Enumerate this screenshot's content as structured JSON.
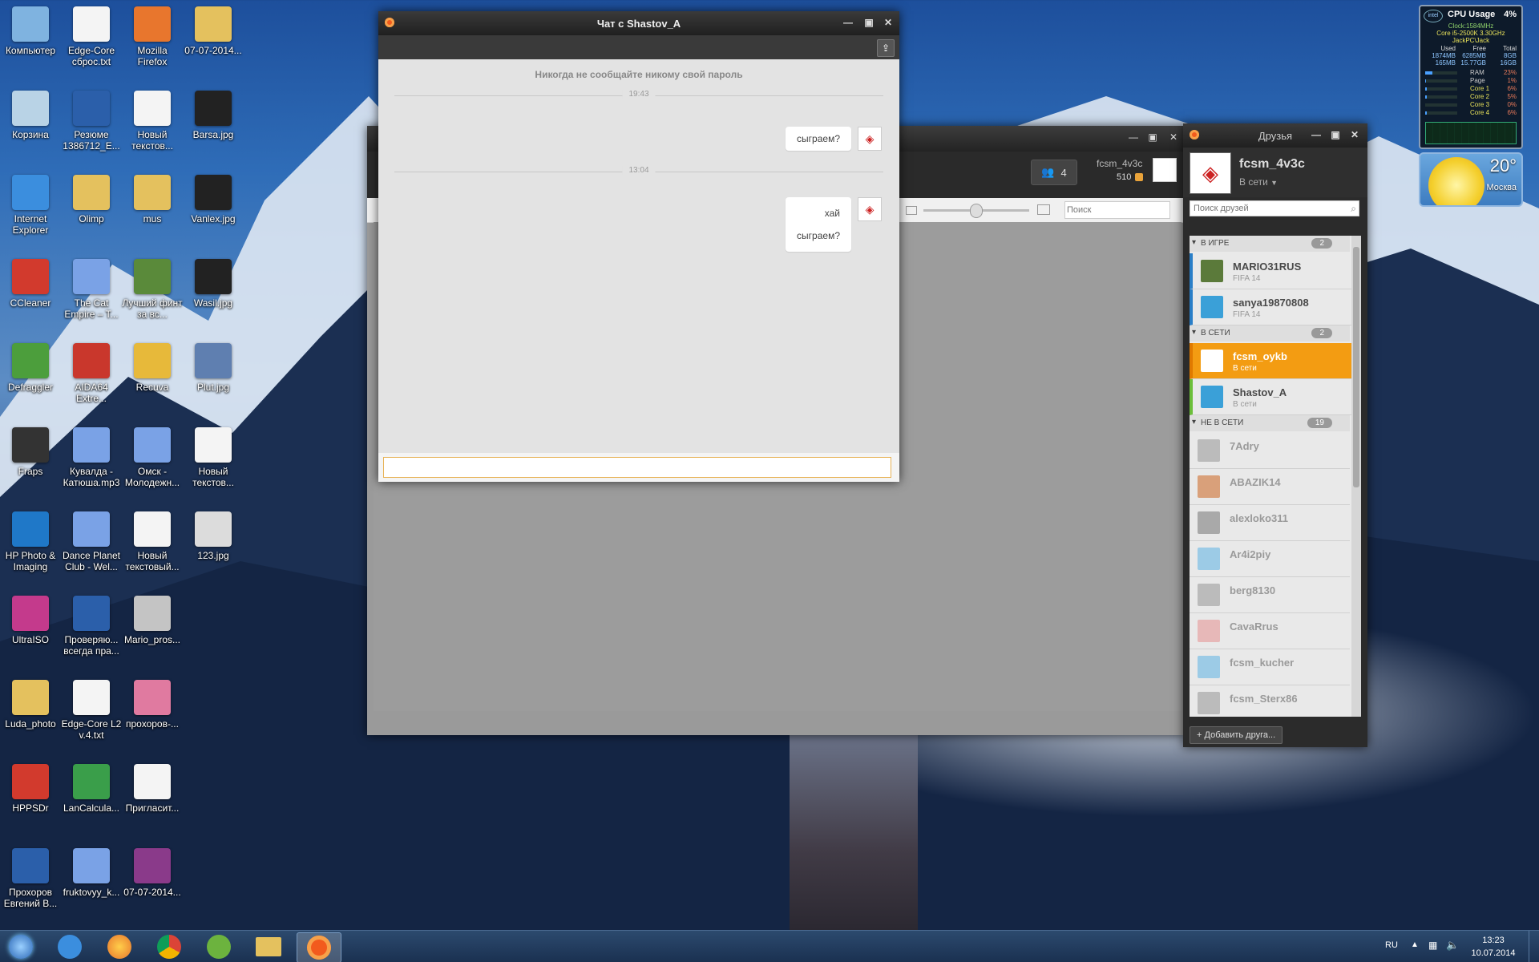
{
  "desktop_icons": [
    {
      "label": "Компьютер",
      "icon": "computer-icon",
      "color": "#7fb3e0"
    },
    {
      "label": "Edge-Core сброс.txt",
      "icon": "text-file-icon",
      "color": "#f4f4f4"
    },
    {
      "label": "Mozilla Firefox",
      "icon": "firefox-icon",
      "color": "#e8762d"
    },
    {
      "label": "07-07-2014...",
      "icon": "folder-icon",
      "color": "#e4c15e"
    },
    {
      "label": "Корзина",
      "icon": "recycle-bin-icon",
      "color": "#b9d3e6"
    },
    {
      "label": "Резюме 1386712_E...",
      "icon": "word-doc-icon",
      "color": "#2b5faa"
    },
    {
      "label": "Новый текстов...",
      "icon": "text-file-icon",
      "color": "#f4f4f4"
    },
    {
      "label": "Barsa.jpg",
      "icon": "image-icon",
      "color": "#222222"
    },
    {
      "label": "Internet Explorer",
      "icon": "ie-icon",
      "color": "#3b8ede"
    },
    {
      "label": "Olimp",
      "icon": "folder-icon",
      "color": "#e4c15e"
    },
    {
      "label": "mus",
      "icon": "folder-icon",
      "color": "#e4c15e"
    },
    {
      "label": "Vanlex.jpg",
      "icon": "image-icon",
      "color": "#222222"
    },
    {
      "label": "CCleaner",
      "icon": "ccleaner-icon",
      "color": "#d23a2d"
    },
    {
      "label": "The Cat Empire – T...",
      "icon": "audio-file-icon",
      "color": "#7aa2e6"
    },
    {
      "label": "Лучший финт за вс...",
      "icon": "video-file-icon",
      "color": "#5a8a3a"
    },
    {
      "label": "Wasil.jpg",
      "icon": "image-icon",
      "color": "#222222"
    },
    {
      "label": "Defraggler",
      "icon": "defraggler-icon",
      "color": "#4c9e3c"
    },
    {
      "label": "AIDA64 Extre...",
      "icon": "aida64-icon",
      "color": "#c9372c"
    },
    {
      "label": "Recuva",
      "icon": "recuva-icon",
      "color": "#e7b93a"
    },
    {
      "label": "Plut.jpg",
      "icon": "image-icon",
      "color": "#5f7fb0"
    },
    {
      "label": "Fraps",
      "icon": "fraps-icon",
      "color": "#333333"
    },
    {
      "label": "Кувалда - Катюша.mp3",
      "icon": "audio-file-icon",
      "color": "#7aa2e6"
    },
    {
      "label": "Омск - Молодежн...",
      "icon": "audio-file-icon",
      "color": "#7aa2e6"
    },
    {
      "label": "Новый текстов...",
      "icon": "text-file-icon",
      "color": "#f4f4f4"
    },
    {
      "label": "HP Photo & Imaging",
      "icon": "hp-photo-icon",
      "color": "#1f78c8"
    },
    {
      "label": "Dance Planet Club - Wel...",
      "icon": "audio-file-icon",
      "color": "#7aa2e6"
    },
    {
      "label": "Новый текстовый...",
      "icon": "text-file-icon",
      "color": "#f4f4f4"
    },
    {
      "label": "123.jpg",
      "icon": "image-icon",
      "color": "#dcdcdc"
    },
    {
      "label": "UltraISO",
      "icon": "ultraiso-icon",
      "color": "#c43a8c"
    },
    {
      "label": "Проверяю... всегда пра...",
      "icon": "word-doc-icon",
      "color": "#2b5faa"
    },
    {
      "label": "Mario_pros...",
      "icon": "image-icon",
      "color": "#c4c4c4"
    },
    {
      "label": "",
      "icon": "",
      "color": ""
    },
    {
      "label": "Luda_photo",
      "icon": "folder-icon",
      "color": "#e4c15e"
    },
    {
      "label": "Edge-Core L2 v.4.txt",
      "icon": "text-file-icon",
      "color": "#f4f4f4"
    },
    {
      "label": "прохоров-...",
      "icon": "image-icon",
      "color": "#e07aa0"
    },
    {
      "label": "",
      "icon": "",
      "color": ""
    },
    {
      "label": "HPPSDr",
      "icon": "hppsdr-icon",
      "color": "#d23a2d"
    },
    {
      "label": "LanCalcula...",
      "icon": "lan-calculator-icon",
      "color": "#3a9e4a"
    },
    {
      "label": "Пригласит...",
      "icon": "text-file-icon",
      "color": "#f4f4f4"
    },
    {
      "label": "",
      "icon": "",
      "color": ""
    },
    {
      "label": "Прохоров Евгений В...",
      "icon": "word-doc-icon",
      "color": "#2b5faa"
    },
    {
      "label": "fruktovyy_k...",
      "icon": "audio-file-icon",
      "color": "#7aa2e6"
    },
    {
      "label": "07-07-2014...",
      "icon": "archive-icon",
      "color": "#8a3a8a"
    },
    {
      "label": "",
      "icon": "",
      "color": ""
    }
  ],
  "chat": {
    "title": "Чат с Shastov_A",
    "warning": "Никогда не сообщайте никому свой пароль",
    "time1": "19:43",
    "msg1": "сыграем?",
    "time2": "13:04",
    "msg2_line1": "хай",
    "msg2_line2": "сыграем?"
  },
  "main_window": {
    "friends_count": "4",
    "user": "fcsm_4v3c",
    "points": "510",
    "search_placeholder": "Поиск"
  },
  "friends": {
    "title": "Друзья",
    "username": "fcsm_4v3c",
    "status": "В сети",
    "search_placeholder": "Поиск друзей",
    "sections": {
      "ingame": {
        "label": "В ИГРЕ",
        "count": "2"
      },
      "online": {
        "label": "В СЕТИ",
        "count": "2"
      },
      "offline": {
        "label": "НЕ В СЕТИ",
        "count": "19"
      }
    },
    "ingame": [
      {
        "name": "MARIO31RUS",
        "status": "FIFA 14"
      },
      {
        "name": "sanya19870808",
        "status": "FIFA 14"
      }
    ],
    "online": [
      {
        "name": "fcsm_oykb",
        "status": "В сети"
      },
      {
        "name": "Shastov_A",
        "status": "В сети"
      }
    ],
    "offline": [
      "7Adry",
      "ABAZIK14",
      "alexloko311",
      "Ar4i2piy",
      "berg8130",
      "CavaRrus",
      "fcsm_kucher",
      "fcsm_Sterx86"
    ],
    "add_button": "Добавить друга..."
  },
  "cpu_gadget": {
    "title": "CPU Usage",
    "percent": "4%",
    "clock": "Clock:1584MHz",
    "model": "Core i5-2500K 3.30GHz",
    "host": "JackPC\\Jack",
    "mem_head": [
      "Used",
      "Free",
      "Total"
    ],
    "mem_rows": [
      [
        "1874MB",
        "6285MB",
        "8GB"
      ],
      [
        "165MB",
        "15.77GB",
        "16GB"
      ]
    ],
    "bars": [
      {
        "label": "RAM",
        "v": "23%"
      },
      {
        "label": "Page",
        "v": "1%"
      },
      {
        "label": "Core 1",
        "v": "6%"
      },
      {
        "label": "Core 2",
        "v": "5%"
      },
      {
        "label": "Core 3",
        "v": "0%"
      },
      {
        "label": "Core 4",
        "v": "6%"
      }
    ]
  },
  "weather": {
    "temp": "20°",
    "city": "Москва"
  },
  "taskbar": {
    "lang": "RU",
    "time": "13:23",
    "date": "10.07.2014"
  }
}
